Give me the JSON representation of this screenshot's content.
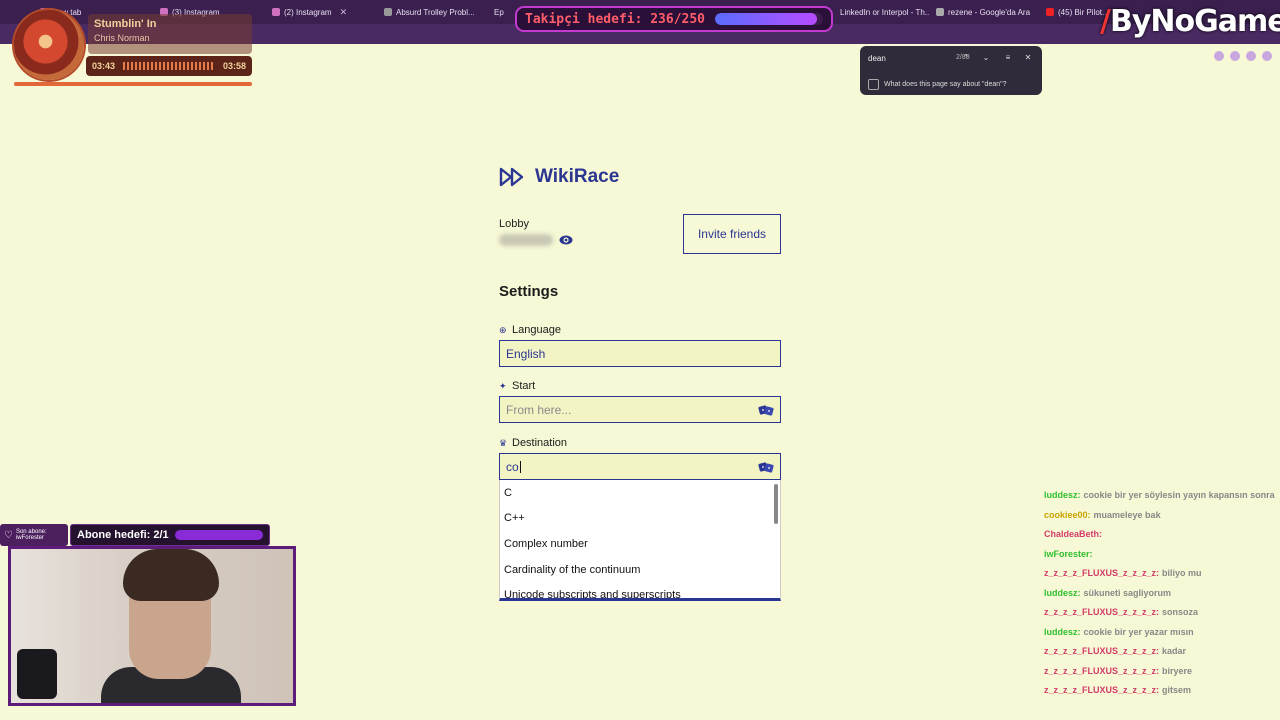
{
  "browser": {
    "tabs": [
      {
        "label": "New tab"
      },
      {
        "label": "(3) Instagram"
      },
      {
        "label": "(2) Instagram"
      },
      {
        "label": "Absurd Trolley Probl..."
      },
      {
        "label": "Ep"
      },
      {
        "label": "LinkedIn or Interpol - Th..."
      },
      {
        "label": "rezene - Google'da Ara"
      },
      {
        "label": "(45) Bir Pilot..."
      }
    ]
  },
  "overlay": {
    "follower_goal": {
      "label": "Takipçi hedefi: 236/250",
      "current": 236,
      "target": 250
    },
    "brand": {
      "main": "ByNoGame"
    },
    "music": {
      "title": "Stumblin' In",
      "artist": "Chris Norman",
      "elapsed": "03:43",
      "duration": "03:58"
    },
    "sub_goal": {
      "label": "Abone hedefi: 2/1"
    },
    "last_sub": {
      "line1": "Son abone:",
      "line2": "iwForester"
    }
  },
  "find_bar": {
    "query": "dean",
    "count": "2/88",
    "ai_prompt": "What does this page say about \"dean\"?"
  },
  "app": {
    "title": "WikiRace",
    "lobby_label": "Lobby",
    "invite_label": "Invite friends",
    "settings_heading": "Settings",
    "language": {
      "label": "Language",
      "value": "English"
    },
    "start": {
      "label": "Start",
      "placeholder": "From here..."
    },
    "destination": {
      "label": "Destination",
      "value": "co"
    },
    "suggestions": [
      "C",
      "C++",
      "Complex number",
      "Cardinality of the continuum",
      "Unicode subscripts and superscripts"
    ]
  },
  "chat": [
    {
      "user": "luddesz:",
      "text": "cookie bir yer söylesin yayın kapansın sonra",
      "color": "#2fbf2f"
    },
    {
      "user": "cookiee00:",
      "text": "muameleye bak",
      "color": "#c9a400"
    },
    {
      "user": "ChaldeaBeth:",
      "text": "",
      "color": "#d23c6a"
    },
    {
      "user": "iwForester:",
      "text": "",
      "color": "#2fbf2f"
    },
    {
      "user": "z_z_z_z_FLUXUS_z_z_z_z:",
      "text": "biliyo mu",
      "color": "#d23c6a"
    },
    {
      "user": "luddesz:",
      "text": "sükuneti sagliyorum",
      "color": "#2fbf2f"
    },
    {
      "user": "z_z_z_z_FLUXUS_z_z_z_z:",
      "text": "sonsoza",
      "color": "#d23c6a"
    },
    {
      "user": "luddesz:",
      "text": "cookie bir yer yazar mısın",
      "color": "#2fbf2f"
    },
    {
      "user": "z_z_z_z_FLUXUS_z_z_z_z:",
      "text": "kadar",
      "color": "#d23c6a"
    },
    {
      "user": "z_z_z_z_FLUXUS_z_z_z_z:",
      "text": "biryere",
      "color": "#d23c6a"
    },
    {
      "user": "z_z_z_z_FLUXUS_z_z_z_z:",
      "text": "gitsem",
      "color": "#d23c6a"
    }
  ]
}
